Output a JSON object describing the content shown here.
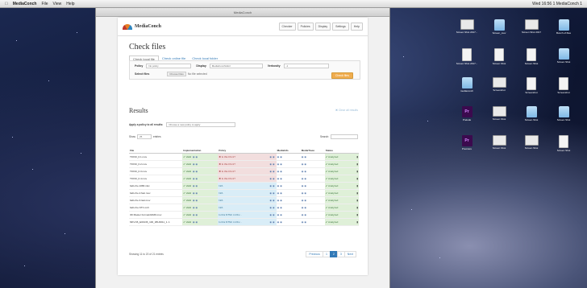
{
  "menubar": {
    "app": "MediaConch",
    "items": [
      "File",
      "View",
      "Help"
    ],
    "clock": "Wed 16:56 1 MediaConch 1"
  },
  "browser": {
    "title": "MediaConch"
  },
  "app": {
    "brand": "MediaConch",
    "nav": [
      "Checker",
      "Policies",
      "Display",
      "Settings",
      "Help"
    ],
    "page_title": "Check files",
    "tabs": [
      "Check local file",
      "Check online file",
      "Check local folder"
    ],
    "form": {
      "policy_label": "Policy",
      "policy_value": "No policy",
      "display_label": "Display",
      "display_value": "MediaConchHtml",
      "verbosity_label": "Verbosity",
      "verbosity_value": "-1",
      "select_files_label": "Select files",
      "choose_label": "Choose Files",
      "no_file": "No file selected",
      "check_button": "Check files"
    },
    "results": {
      "title": "Results",
      "clear_all": "Clear all results",
      "apply_label": "Apply a policy to all results:",
      "apply_placeholder": "Choose a new policy to apply",
      "show_label": "Show",
      "show_value": "25",
      "entries_label": "entries",
      "search_label": "Search:",
      "columns": [
        "File",
        "Implementation",
        "Policy",
        "MediaInfo",
        "MediaTrace",
        "Status"
      ],
      "rows": [
        {
          "file": "TFF33_0.1.mov",
          "impl": "Valid",
          "policy": "Is this FFv1?",
          "fail": true,
          "status": "Analyzed"
        },
        {
          "file": "TFF33_0.2.mov",
          "impl": "Valid",
          "policy": "Is this FFv1?",
          "fail": true,
          "status": "Analyzed"
        },
        {
          "file": "TFF33_0.3.mov",
          "impl": "Valid",
          "policy": "Is this FFv1?",
          "fail": true,
          "status": "Analyzed"
        },
        {
          "file": "TFF33_0.4.mov",
          "impl": "Valid",
          "policy": "Is this FFv1?",
          "fail": true,
          "status": "Analyzed"
        },
        {
          "file": "bafs.rbe.1080.mkv",
          "impl": "Valid",
          "policy": "N/A",
          "fail": false,
          "status": "Analyzed"
        },
        {
          "file": "bafs.rbe.2.fast.mov",
          "impl": "Valid",
          "policy": "N/A",
          "fail": false,
          "status": "Analyzed"
        },
        {
          "file": "bafs.rbe.3.last.mov",
          "impl": "Valid",
          "policy": "N/A",
          "fail": false,
          "status": "Analyzed"
        },
        {
          "file": "bafs.rbe.NTC.m2t",
          "impl": "Valid",
          "policy": "N/A",
          "fail": false,
          "status": "Analyzed"
        },
        {
          "file": "3D Master Format4GMD.mov",
          "impl": "Valid",
          "policy": "Is this NTSC in FFv...",
          "fail": false,
          "status": "Analyzed"
        },
        {
          "file": "MKV.06_E00136_100_1BU0011_1..1",
          "impl": "Valid",
          "policy": "Is this NTSC in FFv...",
          "fail": false,
          "status": "Analyzed"
        }
      ],
      "showing": "Showing 11 to 20 of 21 entries",
      "pager": [
        "Previous",
        "1",
        "2",
        "3",
        "Next"
      ],
      "active_page": "2"
    }
  },
  "desktop_icons": [
    {
      "label": "Screen Shot 2017...",
      "kind": "shot"
    },
    {
      "label": "Screen_mov",
      "kind": "folder"
    },
    {
      "label": "Screen Shot 2017",
      "kind": "shot"
    },
    {
      "label": "Bunch of files",
      "kind": "folder"
    },
    {
      "label": "Screen Shot 2017...",
      "kind": "doc"
    },
    {
      "label": "Screen Shot",
      "kind": "doc"
    },
    {
      "label": "Screen Shot",
      "kind": "doc"
    },
    {
      "label": "Screen Shot",
      "kind": "folder"
    },
    {
      "label": "mediaconch",
      "kind": "folder"
    },
    {
      "label": "Screenshot",
      "kind": "shot"
    },
    {
      "label": "Screenshot",
      "kind": "doc"
    },
    {
      "label": "Screenshot",
      "kind": "doc"
    },
    {
      "label": "Prelude",
      "kind": "pr"
    },
    {
      "label": "Screen Shot",
      "kind": "shot"
    },
    {
      "label": "Screen Shot",
      "kind": "folder"
    },
    {
      "label": "Screen Shot",
      "kind": "folder"
    },
    {
      "label": "Premiere",
      "kind": "pr"
    },
    {
      "label": "Screen Shot",
      "kind": "shot"
    },
    {
      "label": "Screen Shot",
      "kind": "shot"
    },
    {
      "label": "Screen Shot",
      "kind": "doc"
    }
  ],
  "colors": {
    "accent": "#337ab7",
    "valid": "#3c763d",
    "fail": "#a94442",
    "check_button": "#f0ad4e"
  }
}
